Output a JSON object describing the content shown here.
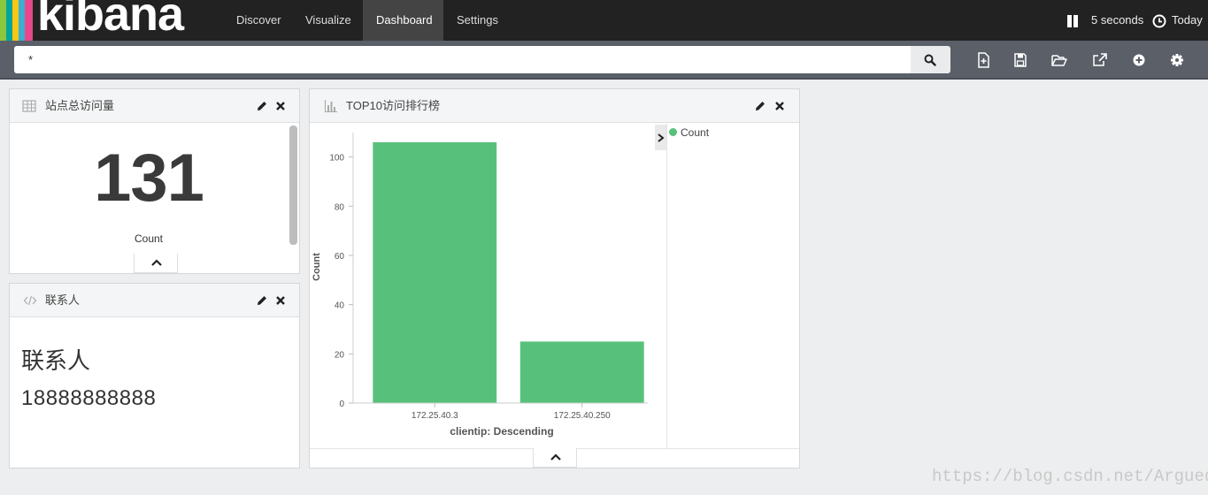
{
  "app": {
    "logo_text": "kibana",
    "logo_colors": [
      "#e8488b",
      "#3caed2",
      "#fec514",
      "#00a69b",
      "#8cc63f"
    ]
  },
  "nav": {
    "tabs": [
      {
        "label": "Discover",
        "active": false
      },
      {
        "label": "Visualize",
        "active": false
      },
      {
        "label": "Dashboard",
        "active": true
      },
      {
        "label": "Settings",
        "active": false
      }
    ],
    "refresh_interval": "5 seconds",
    "time_range": "Today"
  },
  "search": {
    "query": "*",
    "icons": [
      "search-icon"
    ]
  },
  "toolbar": {
    "icons": [
      "new-dashboard-icon",
      "save-icon",
      "open-folder-icon",
      "share-icon",
      "add-panel-icon",
      "gear-icon"
    ]
  },
  "panels": {
    "metric": {
      "title": "站点总访问量",
      "type_icon": "table-icon",
      "value": "131",
      "label": "Count"
    },
    "markdown": {
      "title": "联系人",
      "type_icon": "code-icon",
      "heading": "联系人",
      "phone": "18888888888"
    },
    "bar": {
      "title": "TOP10访问排行榜",
      "type_icon": "bar-chart-icon",
      "legend_label": "Count"
    }
  },
  "colors": {
    "bar": "#57c17b",
    "nav_bg": "#222222",
    "search_strip": "#5a5f68"
  },
  "chart_data": {
    "type": "bar",
    "categories": [
      "172.25.40.3",
      "172.25.40.250"
    ],
    "series": [
      {
        "name": "Count",
        "values": [
          106,
          25
        ]
      }
    ],
    "xlabel": "clientip: Descending",
    "ylabel": "Count",
    "ylim": [
      0,
      110
    ],
    "yticks": [
      0,
      20,
      40,
      60,
      80,
      100
    ],
    "legend": "right"
  },
  "watermark": "https://blog.csdn.net/Argued_D"
}
